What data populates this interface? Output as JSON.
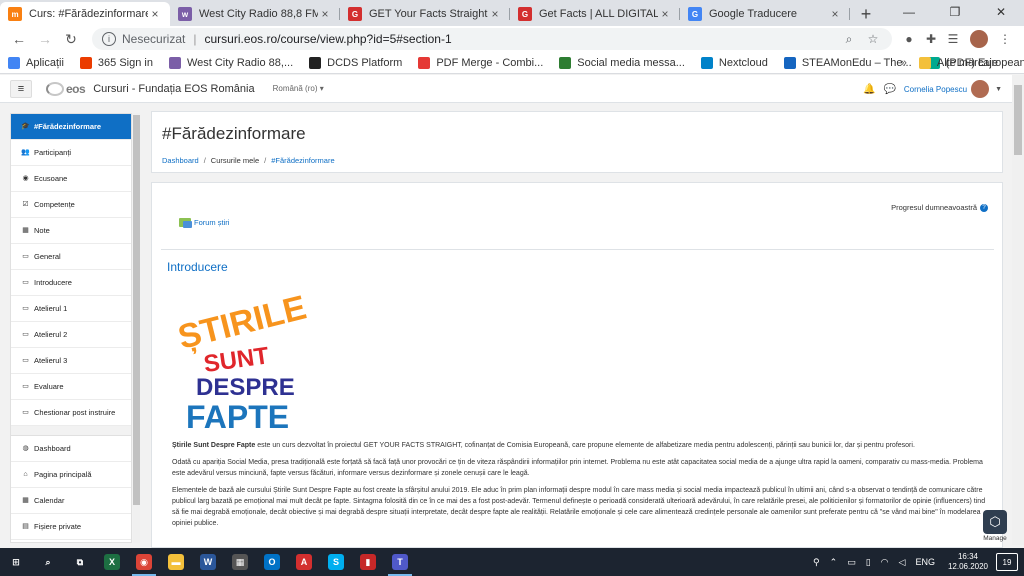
{
  "browser": {
    "tabs": [
      {
        "title": "Curs: #Fărădezinformare",
        "fav": "m",
        "color": "#f98012",
        "active": true
      },
      {
        "title": "West City Radio 88,8 FM -",
        "fav": "w",
        "color": "#7b5ea7",
        "active": false
      },
      {
        "title": "GET Your Facts Straight! online",
        "fav": "G",
        "color": "#d32f2f",
        "active": false
      },
      {
        "title": "Get Facts | ALL DIGITAL Week",
        "fav": "G",
        "color": "#d32f2f",
        "active": false
      },
      {
        "title": "Google Traducere",
        "fav": "G",
        "color": "#4285f4",
        "active": false
      }
    ],
    "new_tab": "+",
    "window_controls": [
      "—",
      "❐",
      "✕"
    ],
    "address": {
      "security": "Nesecurizat",
      "separator": "|",
      "url": "cursuri.eos.ro/course/view.php?id=5#section-1"
    },
    "bookmarks": [
      {
        "label": "Aplicații",
        "color": "#4285f4"
      },
      {
        "label": "365 Sign in",
        "color": "#eb3c00"
      },
      {
        "label": "West City Radio 88,...",
        "color": "#7b5ea7"
      },
      {
        "label": "DCDS Platform",
        "color": "#222"
      },
      {
        "label": "PDF Merge - Combi...",
        "color": "#e53935"
      },
      {
        "label": "Social media messa...",
        "color": "#2e7d32"
      },
      {
        "label": "Nextcloud",
        "color": "#0082c9"
      },
      {
        "label": "STEAMonEdu – The...",
        "color": "#1565c0"
      },
      {
        "label": "(PDF) European STE...",
        "color": "#00a98f"
      }
    ],
    "bookmarks_more": "»",
    "other_bookmarks": "Alte marcaje"
  },
  "moodle": {
    "site_name": "Cursuri - Fundația EOS România",
    "logo_text": "eos",
    "language": "Română (ro) ▾",
    "user": "Cornelia Popescu",
    "sidebar": [
      {
        "label": "#Fărădezinformare",
        "icon": "🎓",
        "active": true
      },
      {
        "label": "Participanți",
        "icon": "👥"
      },
      {
        "label": "Ecusoane",
        "icon": "◉"
      },
      {
        "label": "Competențe",
        "icon": "☑"
      },
      {
        "label": "Note",
        "icon": "▦"
      },
      {
        "label": "General",
        "icon": "▭"
      },
      {
        "label": "Introducere",
        "icon": "▭"
      },
      {
        "label": "Atelierul 1",
        "icon": "▭"
      },
      {
        "label": "Atelierul 2",
        "icon": "▭"
      },
      {
        "label": "Atelierul 3",
        "icon": "▭"
      },
      {
        "label": "Evaluare",
        "icon": "▭"
      },
      {
        "label": "Chestionar post instruire",
        "icon": "▭"
      }
    ],
    "sidebar2": [
      {
        "label": "Dashboard",
        "icon": "◍"
      },
      {
        "label": "Pagina principală",
        "icon": "⌂"
      },
      {
        "label": "Calendar",
        "icon": "▦"
      },
      {
        "label": "Fișiere private",
        "icon": "▤"
      },
      {
        "label": "Cursurile mele",
        "icon": "🎓"
      }
    ],
    "page_title": "#Fărădezinformare",
    "breadcrumb": [
      "Dashboard",
      "Cursurile mele",
      "#Fărădezinformare"
    ],
    "progress_label": "Progresul dumneavoastră",
    "forum_link": "Forum știri",
    "section_title": "Introducere",
    "logo_lines": [
      "ȘTIRILE",
      "SUNT",
      "DESPRE",
      "FAPTE"
    ],
    "paragraphs": [
      {
        "bold": "Știrile Sunt Despre Fapte",
        "text": " este un curs dezvoltat în proiectul GET YOUR FACTS STRAIGHT, cofinanțat de Comisia Europeană, care propune elemente de alfabetizare media pentru adolescenți, părinții sau bunicii lor, dar și pentru profesori."
      },
      {
        "bold": "",
        "text": "Odată cu apariția Social Media, presa tradițională este forțată să facă față unor provocări ce țin de viteza răspândirii informațiilor prin internet. Problema nu este atât capacitatea social media de a ajunge ultra rapid la oameni, comparativ cu mass-media. Problema este adevărul versus minciună, fapte versus făcături, informare versus dezinformare și zonele cenușii care le leagă."
      },
      {
        "bold": "",
        "text": "Elementele de bază ale cursului Știrile Sunt Despre Fapte au fost create la sfârșitul anului 2019. Ele aduc în prim plan informații despre modul în care mass media și social media impactează publicul în ultimii ani, când s-a observat o tendință de comunicare către publicul larg bazată pe emoțional mai mult decât pe fapte. Sintagma folosită din ce în ce mai des a fost post-adevăr. Termenul definește o perioadă considerată ulterioară adevărului, în care relatările presei, ale politicienilor și formatorilor de opinie (influencers) tind să fie mai degrabă emoționale, decât obiective și mai degrabă despre situații interpretate, decât despre fapte ale realității. Relatările emoționale și cele care alimentează credințele personale ale oamenilor sunt preferate pentru că \"se vând mai bine\" în modelarea opiniei publice."
      }
    ],
    "manage_label": "Manage"
  },
  "taskbar": {
    "apps": [
      {
        "name": "start",
        "glyph": "⊞",
        "color": "transparent"
      },
      {
        "name": "search",
        "glyph": "⌕",
        "color": "transparent"
      },
      {
        "name": "task-view",
        "glyph": "⧉",
        "color": "transparent"
      },
      {
        "name": "excel",
        "glyph": "X",
        "color": "#1d6f42"
      },
      {
        "name": "chrome",
        "glyph": "◉",
        "color": "#db4437"
      },
      {
        "name": "explorer",
        "glyph": "▬",
        "color": "#f3c03b"
      },
      {
        "name": "word",
        "glyph": "W",
        "color": "#2b579a"
      },
      {
        "name": "calculator",
        "glyph": "▦",
        "color": "#555"
      },
      {
        "name": "outlook",
        "glyph": "O",
        "color": "#0072c6"
      },
      {
        "name": "acrobat",
        "glyph": "A",
        "color": "#d32f2f"
      },
      {
        "name": "skype",
        "glyph": "S",
        "color": "#00aff0"
      },
      {
        "name": "powerpoint-red",
        "glyph": "▮",
        "color": "#c62828"
      },
      {
        "name": "teams",
        "glyph": "T",
        "color": "#5059c9"
      }
    ],
    "language": "ENG",
    "time": "16:34",
    "date": "12.06.2020",
    "notifications": "19"
  }
}
